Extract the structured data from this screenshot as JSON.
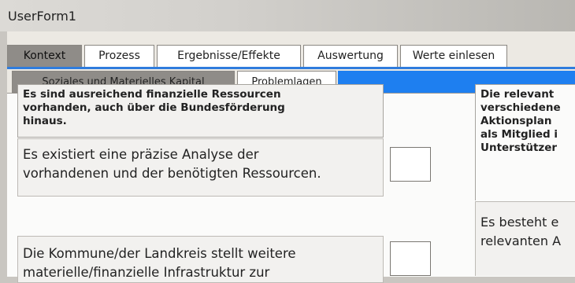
{
  "window": {
    "title": "UserForm1"
  },
  "tabs": [
    {
      "label": "Kontext",
      "active": true
    },
    {
      "label": "Prozess",
      "active": false
    },
    {
      "label": "Ergebnisse/Effekte",
      "active": false
    },
    {
      "label": "Auswertung",
      "active": false
    },
    {
      "label": "Werte einlesen",
      "active": false
    }
  ],
  "subtabs": [
    {
      "label": "Soziales und Materielles Kapital",
      "active": true
    },
    {
      "label": "Problemlagen",
      "active": false
    }
  ],
  "left": {
    "header_lines": [
      "Es sind ausreichend finanzielle Ressourcen",
      "vorhanden, auch über die Bundesförderung",
      "hinaus."
    ],
    "rows": [
      {
        "lines": [
          "Es existiert eine präzise Analyse der",
          "vorhandenen und der benötigten Ressourcen."
        ]
      },
      {
        "lines": [
          "Die Kommune/der Landkreis stellt weitere",
          "materielle/finanzielle Infrastruktur zur"
        ]
      }
    ]
  },
  "right": {
    "header_lines": [
      "Die relevant",
      "verschiedene",
      "Aktionsplan",
      "als Mitglied i",
      "Unterstützer"
    ],
    "row_lines": [
      "Es besteht e",
      "relevanten A"
    ]
  },
  "colors": {
    "accent": "#1e7ff0",
    "active_tab": "#8f8c88"
  }
}
